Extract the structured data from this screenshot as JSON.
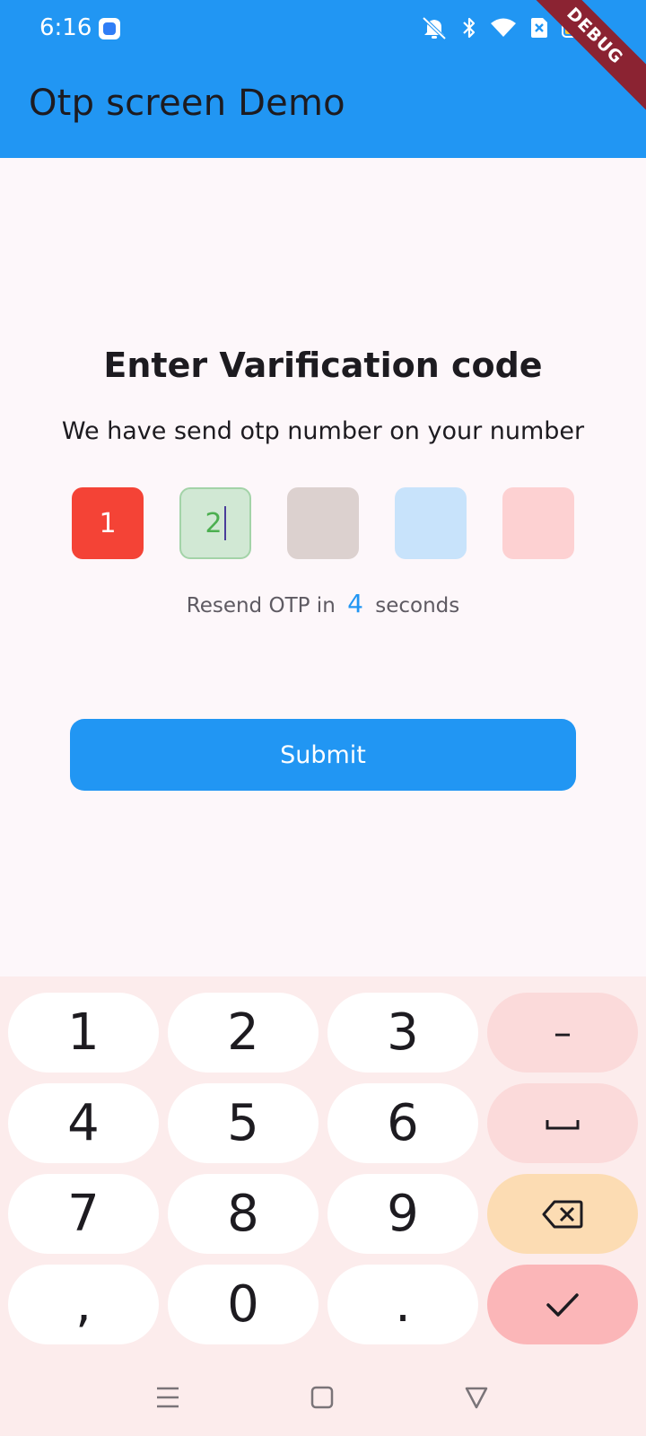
{
  "status_bar": {
    "time": "6:16",
    "icons": [
      "app-icon",
      "mute-icon",
      "bluetooth-icon",
      "wifi-icon",
      "sim-icon",
      "battery-icon"
    ]
  },
  "app_bar": {
    "title": "Otp screen Demo",
    "debug_banner": "DEBUG",
    "color": "#2196f3"
  },
  "otp": {
    "title": "Enter Varification code",
    "subtitle": "We have send otp number on your number",
    "boxes": [
      {
        "value": "1",
        "bg": "#f44336",
        "color": "#ffffff"
      },
      {
        "value": "2",
        "bg": "#d1e8d4",
        "color": "#4caf50",
        "focused": true
      },
      {
        "value": "",
        "bg": "#dcd1cf"
      },
      {
        "value": "",
        "bg": "#c8e3fb"
      },
      {
        "value": "",
        "bg": "#fdd1d2"
      }
    ],
    "resend_prefix": "Resend OTP in",
    "resend_count": "4",
    "resend_suffix": "seconds",
    "submit_label": "Submit"
  },
  "keyboard": {
    "rows": [
      [
        "1",
        "2",
        "3",
        "–"
      ],
      [
        "4",
        "5",
        "6",
        "space"
      ],
      [
        "7",
        "8",
        "9",
        "backspace"
      ],
      [
        ",",
        "0",
        ".",
        "done"
      ]
    ]
  },
  "nav_bar": {
    "icons": [
      "menu-icon",
      "home-icon",
      "back-icon"
    ]
  }
}
